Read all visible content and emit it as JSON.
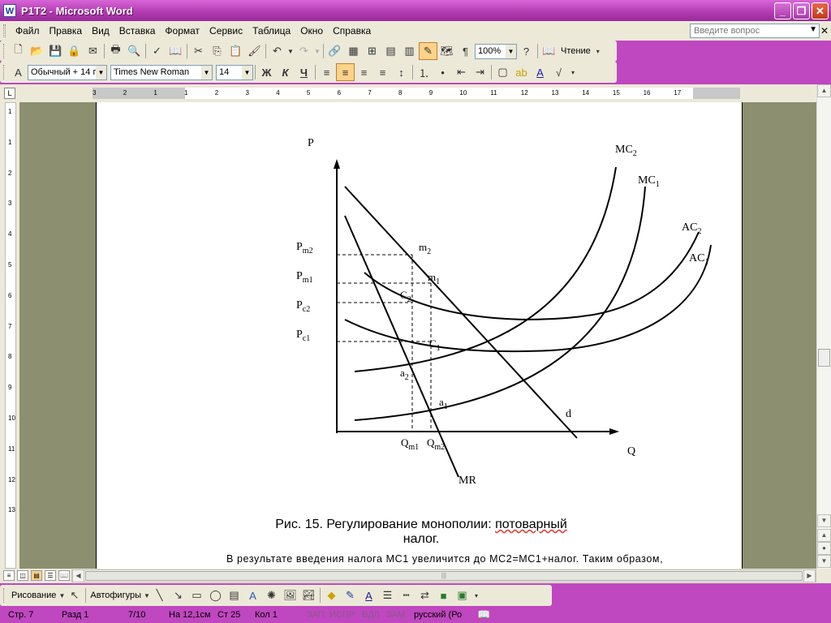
{
  "window": {
    "title": "P1T2 - Microsoft Word",
    "app_icon": "W",
    "controls": [
      "_",
      "❐",
      "✕"
    ]
  },
  "menu": {
    "items": [
      "Файл",
      "Правка",
      "Вид",
      "Вставка",
      "Формат",
      "Сервис",
      "Таблица",
      "Окно",
      "Справка"
    ],
    "help_placeholder": "Введите вопрос"
  },
  "standard_toolbar": {
    "zoom": "100%",
    "read_label": "Чтение"
  },
  "format_toolbar": {
    "style": "Обычный + 14 г",
    "font": "Times New Roman",
    "size": "14",
    "bold": "Ж",
    "italic": "К",
    "underline": "Ч"
  },
  "ruler": {
    "h_labels": [
      "3",
      "2",
      "1",
      "1",
      "2",
      "3",
      "4",
      "5",
      "6",
      "7",
      "8",
      "9",
      "10",
      "11",
      "12",
      "13",
      "14",
      "15",
      "16",
      "17"
    ],
    "v_labels": [
      "1",
      "1",
      "2",
      "3",
      "4",
      "5",
      "6",
      "7",
      "8",
      "9",
      "10",
      "11",
      "12",
      "13"
    ]
  },
  "chart_data": {
    "type": "line",
    "axis_labels": {
      "y": "P",
      "x": "Q"
    },
    "price_labels": [
      {
        "main": "P",
        "sub": "m2"
      },
      {
        "main": "P",
        "sub": "m1"
      },
      {
        "main": "P",
        "sub": "c2"
      },
      {
        "main": "P",
        "sub": "c1"
      }
    ],
    "quantity_labels": [
      {
        "main": "Q",
        "sub": "m1"
      },
      {
        "main": "Q",
        "sub": "m2"
      }
    ],
    "curve_labels": [
      {
        "main": "MC",
        "sub": "2"
      },
      {
        "main": "MC",
        "sub": "1"
      },
      {
        "main": "AC",
        "sub": "2"
      },
      {
        "main": "AC",
        "sub": "1"
      },
      {
        "main": "d",
        "sub": ""
      },
      {
        "main": "MR",
        "sub": ""
      }
    ],
    "point_labels": [
      {
        "main": "m",
        "sub": "2"
      },
      {
        "main": "m",
        "sub": "1"
      },
      {
        "main": "C",
        "sub": "2"
      },
      {
        "main": "C",
        "sub": "1"
      },
      {
        "main": "a",
        "sub": "2"
      },
      {
        "main": "a",
        "sub": "1"
      }
    ]
  },
  "document": {
    "caption_start": "Рис. 15. Регулирование монополии: ",
    "caption_err": "потоварный",
    "caption_end": " налог.",
    "body": "В результате введения налога МС1 увеличится до МС2=МС1+налог. Таким образом,"
  },
  "drawing_toolbar": {
    "draw_label": "Рисование",
    "autoshapes_label": "Автофигуры"
  },
  "status_bar": {
    "page": "Стр. 7",
    "section": "Разд 1",
    "pages": "7/10",
    "at": "На 12,1см",
    "line": "Ст 25",
    "col": "Кол 1",
    "rec": "ЗАП",
    "trk": "ИСПР",
    "ext": "ВДЛ",
    "ovr": "ЗАМ",
    "lang": "русский (Ро"
  }
}
